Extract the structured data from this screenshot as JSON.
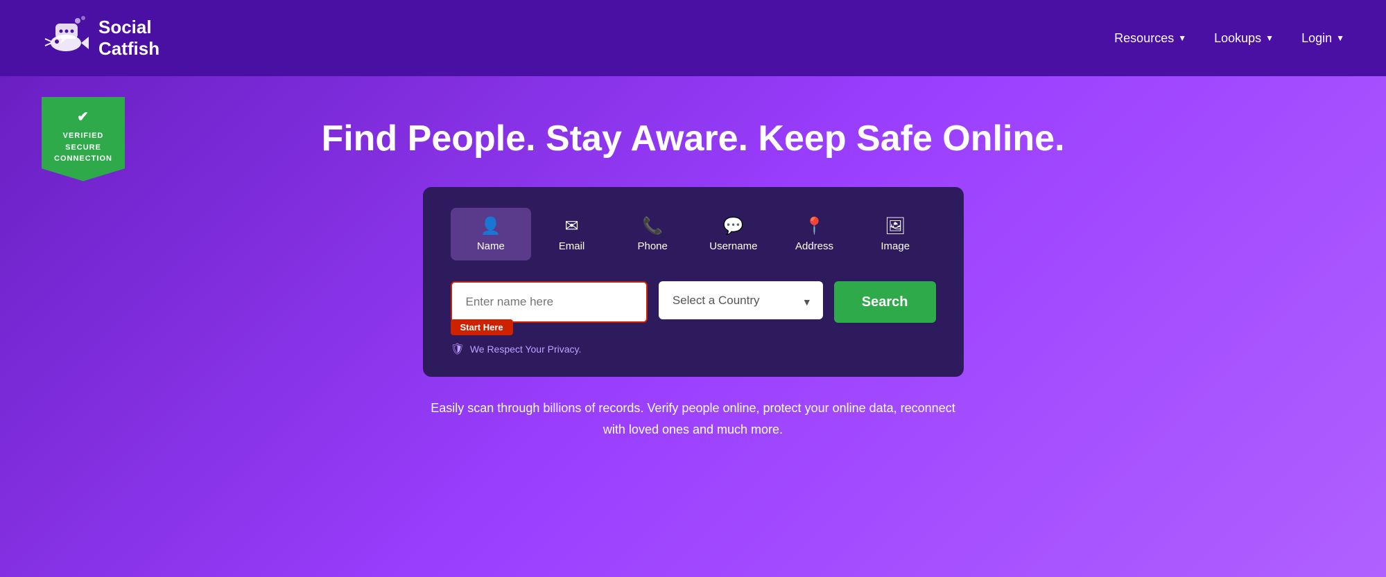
{
  "header": {
    "logo_text_line1": "Social",
    "logo_text_line2": "Catfish",
    "nav": [
      {
        "label": "Resources",
        "id": "resources"
      },
      {
        "label": "Lookups",
        "id": "lookups"
      },
      {
        "label": "Login",
        "id": "login"
      }
    ]
  },
  "badge": {
    "line1": "VERIFIED",
    "line2": "SECURE",
    "line3": "CONNECTION"
  },
  "hero": {
    "headline": "Find People. Stay Aware. Keep Safe Online.",
    "subtext": "Easily scan through billions of records. Verify people online, protect your online data, reconnect with\nloved ones and much more."
  },
  "search_card": {
    "tabs": [
      {
        "id": "name",
        "label": "Name",
        "active": true
      },
      {
        "id": "email",
        "label": "Email",
        "active": false
      },
      {
        "id": "phone",
        "label": "Phone",
        "active": false
      },
      {
        "id": "username",
        "label": "Username",
        "active": false
      },
      {
        "id": "address",
        "label": "Address",
        "active": false
      },
      {
        "id": "image",
        "label": "Image",
        "active": false
      }
    ],
    "name_placeholder": "Enter name here",
    "country_placeholder": "Select a Country",
    "start_here_label": "Start Here",
    "search_button_label": "Search",
    "privacy_text": "We Respect Your Privacy."
  }
}
